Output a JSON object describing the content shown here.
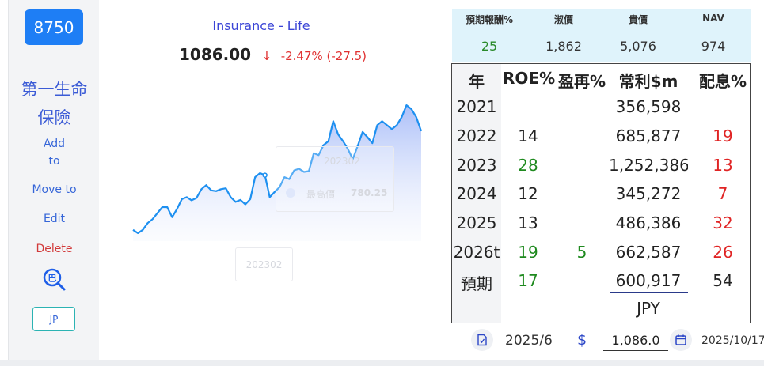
{
  "sidebar": {
    "code": "8750",
    "company_line1": "第一生命",
    "company_line2": "保險",
    "add_line1": "Add",
    "add_line2": "to",
    "move_to": "Move to",
    "edit": "Edit",
    "delete": "Delete",
    "search_glyph": "巴",
    "market": "JP"
  },
  "header": {
    "sector": "Insurance - Life",
    "price": "1086.00",
    "change_arrow": "↓",
    "change": "-2.47% (-27.5)"
  },
  "chart_tooltip": {
    "date": "202302",
    "label": "最高價",
    "value": "780.25",
    "axis_date": "202302"
  },
  "chart_data": {
    "type": "area",
    "x": [
      0,
      1,
      2,
      3,
      4,
      5,
      6,
      7,
      8,
      9,
      10,
      11,
      12,
      13,
      14,
      15,
      16,
      17,
      18,
      19,
      20,
      21,
      22,
      23,
      24,
      25,
      26,
      27,
      28,
      29,
      30,
      31,
      32,
      33,
      34,
      35,
      36,
      37,
      38,
      39,
      40,
      41,
      42,
      43,
      44,
      45,
      46,
      47,
      48,
      49,
      50,
      51,
      52,
      53,
      54,
      55,
      56,
      57,
      58,
      59
    ],
    "values": [
      528,
      520,
      528,
      545,
      555,
      570,
      585,
      585,
      560,
      580,
      605,
      610,
      602,
      608,
      630,
      640,
      627,
      625,
      630,
      632,
      610,
      598,
      603,
      592,
      605,
      660,
      670,
      665,
      610,
      623,
      635,
      660,
      655,
      677,
      681,
      673,
      675,
      720,
      715,
      740,
      750,
      800,
      767,
      750,
      730,
      705,
      738,
      773,
      760,
      745,
      790,
      800,
      790,
      780,
      790,
      810,
      840,
      830,
      810,
      775
    ],
    "highlight": {
      "date": "202302",
      "series": "最高價",
      "value": 780.25
    }
  },
  "metrics": {
    "headers": [
      "預期報酬%",
      "淑價",
      "貴價",
      "NAV"
    ],
    "values": [
      "25",
      "1,862",
      "5,076",
      "974"
    ]
  },
  "financials": {
    "headers": [
      "年",
      "ROE%",
      "盈再%",
      "常利$m",
      "配息%"
    ],
    "rows": [
      {
        "year": "2021",
        "roe": "",
        "reinvest": "",
        "income": "356,598",
        "dividend": ""
      },
      {
        "year": "2022",
        "roe": "14",
        "reinvest": "",
        "income": "685,877",
        "dividend": "19"
      },
      {
        "year": "2023",
        "roe": "28",
        "reinvest": "",
        "income": "1,252,386",
        "dividend": "13"
      },
      {
        "year": "2024",
        "roe": "12",
        "reinvest": "",
        "income": "345,272",
        "dividend": "7"
      },
      {
        "year": "2025",
        "roe": "13",
        "reinvest": "",
        "income": "486,386",
        "dividend": "32"
      },
      {
        "year": "2026t",
        "roe": "19",
        "reinvest": "5",
        "income": "662,587",
        "dividend": "26"
      },
      {
        "year": "預期",
        "roe": "17",
        "reinvest": "",
        "income": "600,917",
        "dividend": "54"
      }
    ],
    "currency": "JPY"
  },
  "bottom": {
    "period": "2025/6",
    "dollar_sign": "$",
    "price_input": "1,086.0",
    "date": "2025/10/17"
  },
  "colors": {
    "accent": "#1e7ef5",
    "line": "#1e90f0",
    "up_green": "#1f8a1f",
    "down_red": "#e02424",
    "header_bg": "#dff3fb"
  }
}
